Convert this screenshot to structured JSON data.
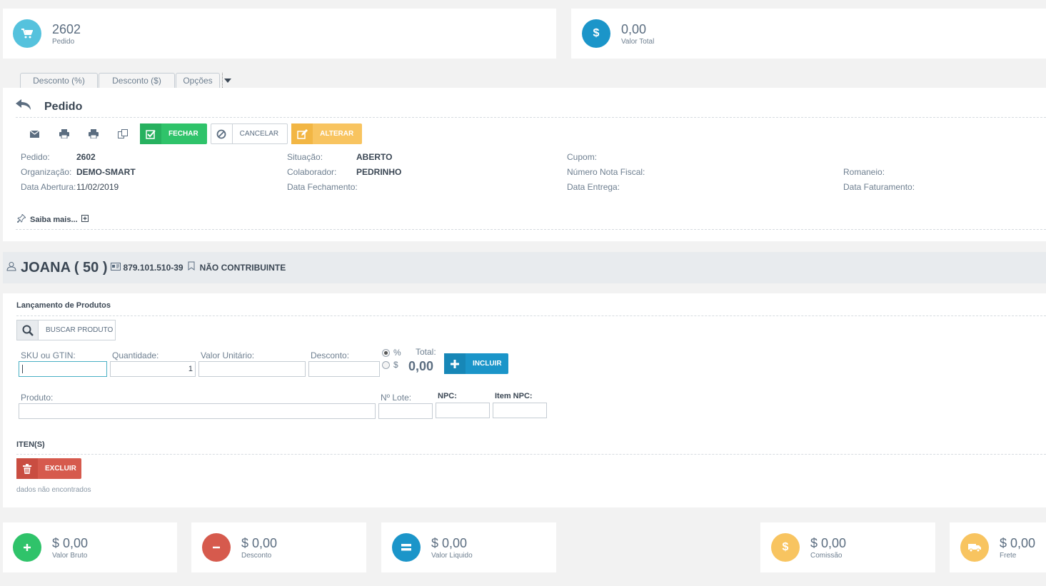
{
  "top_cards": {
    "pedido": {
      "value": "2602",
      "label": "Pedido",
      "icon": "cart-icon",
      "color": "#55c2dd"
    },
    "valor_total": {
      "value": "0,00",
      "label": "Valor Total",
      "icon": "dollar-icon",
      "color": "#1b95c9"
    }
  },
  "tabs": [
    "Desconto (%)",
    "Desconto ($)",
    "Opções"
  ],
  "header": {
    "title": "Pedido"
  },
  "toolbar": {
    "fechar": "FECHAR",
    "cancelar": "CANCELAR",
    "alterar": "ALTERAR"
  },
  "info": {
    "pedido_label": "Pedido:",
    "pedido_value": "2602",
    "organizacao_label": "Organização:",
    "organizacao_value": "DEMO-SMART",
    "data_abertura_label": "Data Abertura:",
    "data_abertura_value": "11/02/2019",
    "situacao_label": "Situação:",
    "situacao_value": "ABERTO",
    "colaborador_label": "Colaborador:",
    "colaborador_value": "PEDRINHO",
    "data_fechamento_label": "Data Fechamento:",
    "cupom_label": "Cupom:",
    "nota_fiscal_label": "Número Nota Fiscal:",
    "data_entrega_label": "Data Entrega:",
    "romaneio_label": "Romaneio:",
    "data_faturamento_label": "Data Faturamento:"
  },
  "saiba_mais": "Saiba mais...",
  "client": {
    "name": "JOANA ( 50 )",
    "document": "879.101.510-39",
    "tax_status": "NÃO CONTRIBUINTE"
  },
  "products": {
    "section_title": "Lançamento de Produtos",
    "search_button": "BUSCAR PRODUTO",
    "sku_label": "SKU ou GTIN:",
    "quantidade_label": "Quantidade:",
    "quantidade_value": "1",
    "valor_unitario_label": "Valor Unitário:",
    "desconto_label": "Desconto:",
    "pct_label": "%",
    "dollar_label": "$",
    "total_label": "Total:",
    "total_value": "0,00",
    "incluir_button": "INCLUIR",
    "produto_label": "Produto:",
    "lote_label": "Nº Lote:",
    "npc_label": "NPC:",
    "item_npc_label": "Item NPC:"
  },
  "items": {
    "title": "ITEN(S)",
    "excluir_button": "EXCLUIR",
    "empty_text": "dados não encontrados"
  },
  "bottom_cards": [
    {
      "value": "$ 0,00",
      "label": "Valor Bruto",
      "icon": "plus-icon",
      "color": "#2fc36a"
    },
    {
      "value": "$ 0,00",
      "label": "Desconto",
      "icon": "minus-icon",
      "color": "#d65a4d"
    },
    {
      "value": "$ 0,00",
      "label": "Valor Liquido",
      "icon": "equals-icon",
      "color": "#1b95c9"
    },
    {
      "value": "$ 0,00",
      "label": "Comissão",
      "icon": "dollar-icon",
      "color": "#f8c460"
    },
    {
      "value": "$ 0,00",
      "label": "Frete",
      "icon": "truck-icon",
      "color": "#f8c460"
    }
  ]
}
